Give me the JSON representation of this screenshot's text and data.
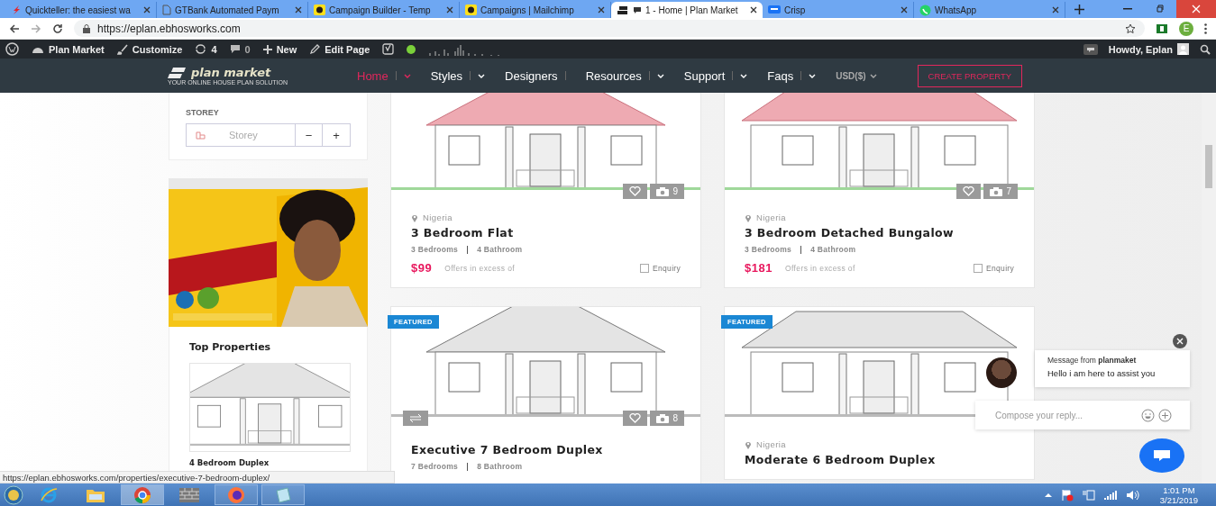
{
  "browser": {
    "tabs": [
      {
        "title": "Quickteller: the easiest wa",
        "selected": false
      },
      {
        "title": "GTBank Automated Paym",
        "selected": false
      },
      {
        "title": "Campaign Builder - Temp",
        "selected": false
      },
      {
        "title": "Campaigns | Mailchimp",
        "selected": false
      },
      {
        "title": "1 - Home | Plan Market",
        "selected": true
      },
      {
        "title": "Crisp",
        "selected": false
      },
      {
        "title": "WhatsApp",
        "selected": false
      }
    ],
    "url": "https://eplan.ebhosworks.com",
    "profile_initial": "E"
  },
  "admin_bar": {
    "site": "Plan Market",
    "customize": "Customize",
    "updates": "4",
    "comments": "0",
    "new": "New",
    "edit": "Edit Page",
    "greeting": "Howdy, Eplan"
  },
  "header": {
    "logo_name": "plan market",
    "logo_tagline": "YOUR ONLINE HOUSE PLAN SOLUTION",
    "menu": [
      {
        "label": "Home",
        "selected": true,
        "dropdown": true
      },
      {
        "label": "Styles",
        "selected": false,
        "dropdown": true
      },
      {
        "label": "Designers",
        "selected": false,
        "dropdown": false
      },
      {
        "label": "Resources",
        "selected": false,
        "dropdown": true
      },
      {
        "label": "Support",
        "selected": false,
        "dropdown": true
      },
      {
        "label": "Faqs",
        "selected": false,
        "dropdown": true
      }
    ],
    "currency": "USD($)",
    "cta": "CREATE PROPERTY"
  },
  "sidebar": {
    "filter": {
      "label": "STOREY",
      "placeholder": "Storey",
      "minus": "−",
      "plus": "+"
    },
    "top_properties": {
      "title": "Top Properties",
      "items": [
        {
          "title": "4 Bedroom Duplex"
        }
      ]
    }
  },
  "properties": [
    {
      "featured": false,
      "photos": "9",
      "compare": false,
      "location": "Nigeria",
      "title": "3 Bedroom Flat",
      "bedrooms": "3 Bedrooms",
      "bathrooms": "4 Bathroom",
      "price": "$99",
      "price_note": "Offers in excess of",
      "enquiry": "Enquiry",
      "enquiry_checked": false
    },
    {
      "featured": false,
      "photos": "7",
      "compare": false,
      "location": "Nigeria",
      "title": "3 Bedroom Detached Bungalow",
      "bedrooms": "3 Bedrooms",
      "bathrooms": "4 Bathroom",
      "price": "$181",
      "price_note": "Offers in excess of",
      "enquiry": "Enquiry",
      "enquiry_checked": false
    },
    {
      "featured": true,
      "badge": "FEATURED",
      "photos": "8",
      "compare": true,
      "title": "Executive 7 Bedroom Duplex",
      "bedrooms": "7 Bedrooms",
      "bathrooms": "8 Bathroom"
    },
    {
      "featured": true,
      "badge": "FEATURED",
      "compare": false,
      "location": "Nigeria",
      "title": "Moderate 6 Bedroom Duplex"
    }
  ],
  "chat": {
    "message_header": "Message from **planmaket**",
    "message": "Hello i am here to assist you",
    "placeholder": "Compose your reply..."
  },
  "status_url": "https://eplan.ebhosworks.com/properties/executive-7-bedroom-duplex/",
  "taskbar": {
    "apps": [
      {
        "running": false,
        "selected": false
      },
      {
        "running": false,
        "selected": false
      },
      {
        "running": true,
        "selected": true
      },
      {
        "running": false,
        "selected": false
      },
      {
        "running": true,
        "selected": false
      },
      {
        "running": true,
        "selected": false
      }
    ],
    "time": "1:01 PM",
    "date": "3/21/2019"
  }
}
